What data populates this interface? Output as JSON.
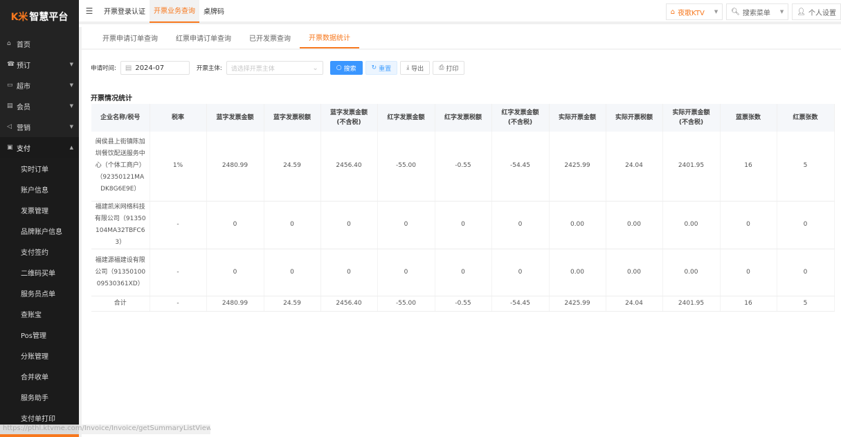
{
  "brand": {
    "logo_mark": "K米",
    "name": "智慧平台"
  },
  "sidebar": {
    "items": [
      {
        "label": "首页",
        "icon": "home-icon"
      },
      {
        "label": "预订",
        "icon": "booking-icon"
      },
      {
        "label": "超市",
        "icon": "shop-icon"
      },
      {
        "label": "会员",
        "icon": "member-card-icon"
      },
      {
        "label": "营销",
        "icon": "megaphone-icon"
      },
      {
        "label": "支付",
        "icon": "payment-icon"
      }
    ],
    "sub_items": [
      "实时订单",
      "账户信息",
      "发票管理",
      "品牌账户信息",
      "支付签约",
      "二维码买单",
      "服务员点单",
      "查账宝",
      "Pos管理",
      "分账管理",
      "合并收单",
      "服务助手",
      "支付单打印"
    ]
  },
  "top_tabs": [
    "开票登录认证",
    "开票业务查询",
    "桌牌码"
  ],
  "top_right": {
    "store": "夜歌KTV",
    "search_menu": "搜索菜单",
    "settings": "个人设置"
  },
  "sub_tabs": [
    "开票申请订单查询",
    "红票申请订单查询",
    "已开发票查询",
    "开票数据统计"
  ],
  "filters": {
    "date_label": "申请时间:",
    "date_value": "2024-07",
    "entity_label": "开票主体:",
    "entity_placeholder": "请选择开票主体",
    "search": "搜索",
    "reset": "重置",
    "export": "导出",
    "print": "打印"
  },
  "section_title": "开票情况统计",
  "table": {
    "headers": [
      "企业名称/税号",
      "税率",
      "蓝字发票金额",
      "蓝字发票税额",
      "蓝字发票金额\n(不含税)",
      "红字发票金额",
      "红字发票税额",
      "红字发票金额\n(不含税)",
      "实际开票金额",
      "实际开票税额",
      "实际开票金额\n(不含税)",
      "蓝票张数",
      "红票张数"
    ],
    "rows": [
      [
        "闽侯县上街镇陈加圳餐饮配送服务中心（个体工商户）（92350121MADK8G6E9E）",
        "1%",
        "2480.99",
        "24.59",
        "2456.40",
        "-55.00",
        "-0.55",
        "-54.45",
        "2425.99",
        "24.04",
        "2401.95",
        "16",
        "5"
      ],
      [
        "福建凯米网络科技有限公司（91350104MA32TBFC63）",
        "-",
        "0",
        "0",
        "0",
        "0",
        "0",
        "0",
        "0.00",
        "0.00",
        "0.00",
        "0",
        "0"
      ],
      [
        "福建源福建设有限公司（9135010009530361XD）",
        "-",
        "0",
        "0",
        "0",
        "0",
        "0",
        "0",
        "0.00",
        "0.00",
        "0.00",
        "0",
        "0"
      ],
      [
        "合计",
        "-",
        "2480.99",
        "24.59",
        "2456.40",
        "-55.00",
        "-0.55",
        "-54.45",
        "2425.99",
        "24.04",
        "2401.95",
        "16",
        "5"
      ]
    ]
  },
  "status_url": "https://pthl.ktvme.com/Invoice/Invoice/getSummaryListView",
  "colors": {
    "accent": "#f7781e",
    "primary": "#3a96ff",
    "sidebar": "#232323"
  }
}
